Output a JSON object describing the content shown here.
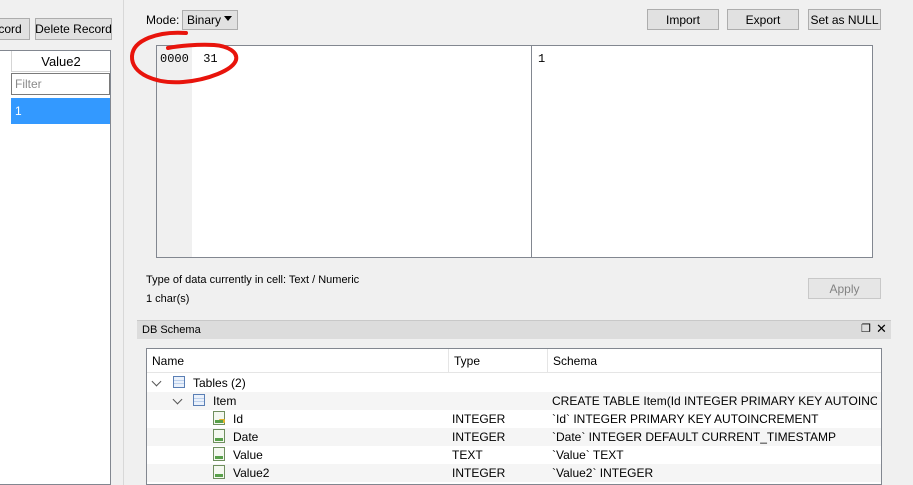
{
  "left": {
    "buttons": {
      "new_record_partial": "cord",
      "delete_record": "Delete Record"
    },
    "table": {
      "column_header": "Value2",
      "filter_placeholder": "Filter",
      "selected_cell": "1"
    }
  },
  "editor": {
    "mode_label": "Mode:",
    "mode_value": "Binary",
    "buttons": {
      "import": "Import",
      "export": "Export",
      "set_null": "Set as NULL",
      "apply": "Apply"
    },
    "hex_line": "0000  31",
    "ascii_line": "1",
    "type_info": "Type of data currently in cell: Text / Numeric",
    "size_info": "1 char(s)",
    "annotation_color": "#e8140c"
  },
  "schema": {
    "title": "DB Schema",
    "columns": [
      "Name",
      "Type",
      "Schema"
    ],
    "rows": [
      {
        "name": "Tables (2)",
        "type": "",
        "schema": ""
      },
      {
        "name": "Item",
        "type": "",
        "schema": "CREATE TABLE Item(Id INTEGER PRIMARY KEY AUTOINCRE..."
      },
      {
        "name": "Id",
        "type": "INTEGER",
        "schema": "`Id` INTEGER PRIMARY KEY AUTOINCREMENT"
      },
      {
        "name": "Date",
        "type": "INTEGER",
        "schema": "`Date` INTEGER DEFAULT CURRENT_TIMESTAMP"
      },
      {
        "name": "Value",
        "type": "TEXT",
        "schema": "`Value` TEXT"
      },
      {
        "name": "Value2",
        "type": "INTEGER",
        "schema": "`Value2` INTEGER"
      }
    ]
  },
  "icons": {
    "mode_dropdown": "chevron-down-icon",
    "tables_group": "table-icon",
    "field": "field-icon",
    "primary_key": "key-icon",
    "dock_float": "float-icon",
    "dock_close": "close-icon"
  }
}
